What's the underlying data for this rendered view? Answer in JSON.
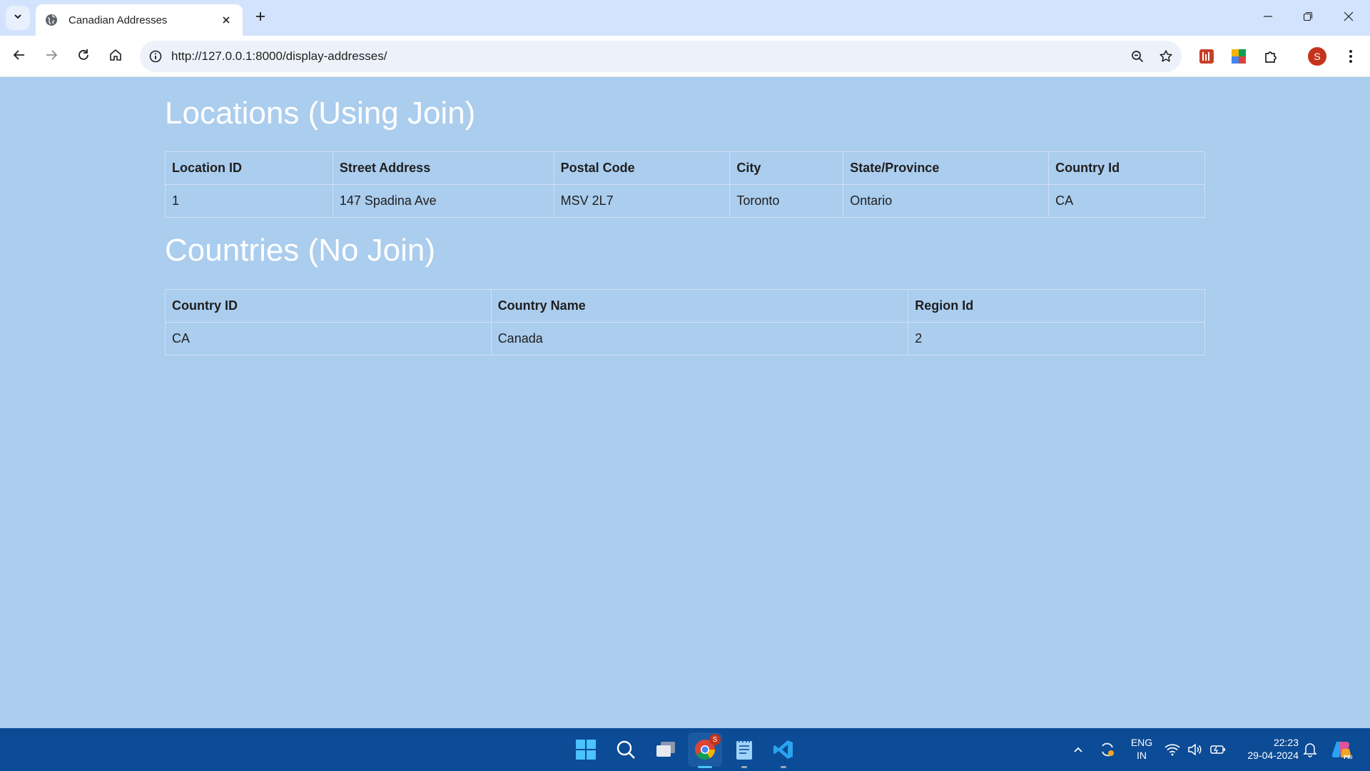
{
  "browser": {
    "tab_title": "Canadian Addresses",
    "url": "http://127.0.0.1:8000/display-addresses/",
    "profile_initial": "S"
  },
  "locations": {
    "title": "Locations (Using Join)",
    "headers": [
      "Location ID",
      "Street Address",
      "Postal Code",
      "City",
      "State/Province",
      "Country Id"
    ],
    "rows": [
      [
        "1",
        "147 Spadina Ave",
        "MSV 2L7",
        "Toronto",
        "Ontario",
        "CA"
      ]
    ]
  },
  "countries": {
    "title": "Countries (No Join)",
    "headers": [
      "Country ID",
      "Country Name",
      "Region Id"
    ],
    "rows": [
      [
        "CA",
        "Canada",
        "2"
      ]
    ]
  },
  "taskbar": {
    "language_line1": "ENG",
    "language_line2": "IN",
    "time": "22:23",
    "date": "29-04-2024",
    "chrome_badge": "S"
  },
  "colors": {
    "page_background": "#abcdee",
    "taskbar": "#0c4b95",
    "tab_strip": "#d3e3fd"
  }
}
